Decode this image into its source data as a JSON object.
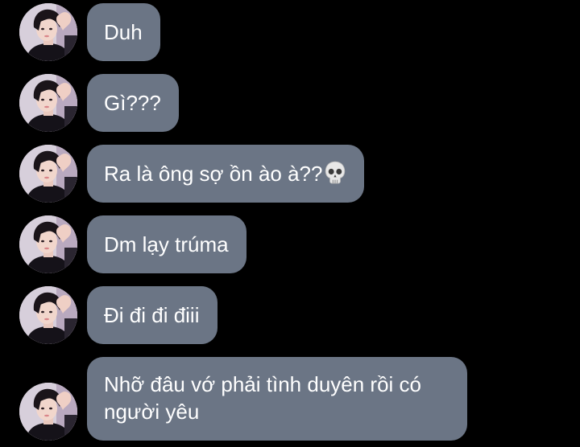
{
  "conversation": {
    "messages": [
      {
        "text": "Duh",
        "avatar_icon": "profile-photo-avatar"
      },
      {
        "text": "Gì???",
        "avatar_icon": "profile-photo-avatar"
      },
      {
        "text": "Ra là ông sợ ồn ào à??",
        "emoji": "skull-emoji",
        "avatar_icon": "profile-photo-avatar"
      },
      {
        "text": "Dm lạy trúma",
        "avatar_icon": "profile-photo-avatar"
      },
      {
        "text": "Đi đi đi điii",
        "avatar_icon": "profile-photo-avatar"
      },
      {
        "text_line1": "Nhỡ đâu vớ phải tình duyên rồi có",
        "text_line2": "người yêu",
        "avatar_icon": "profile-photo-avatar"
      }
    ]
  },
  "colors": {
    "background": "#000000",
    "bubble": "#6b7585",
    "text": "#ffffff"
  }
}
